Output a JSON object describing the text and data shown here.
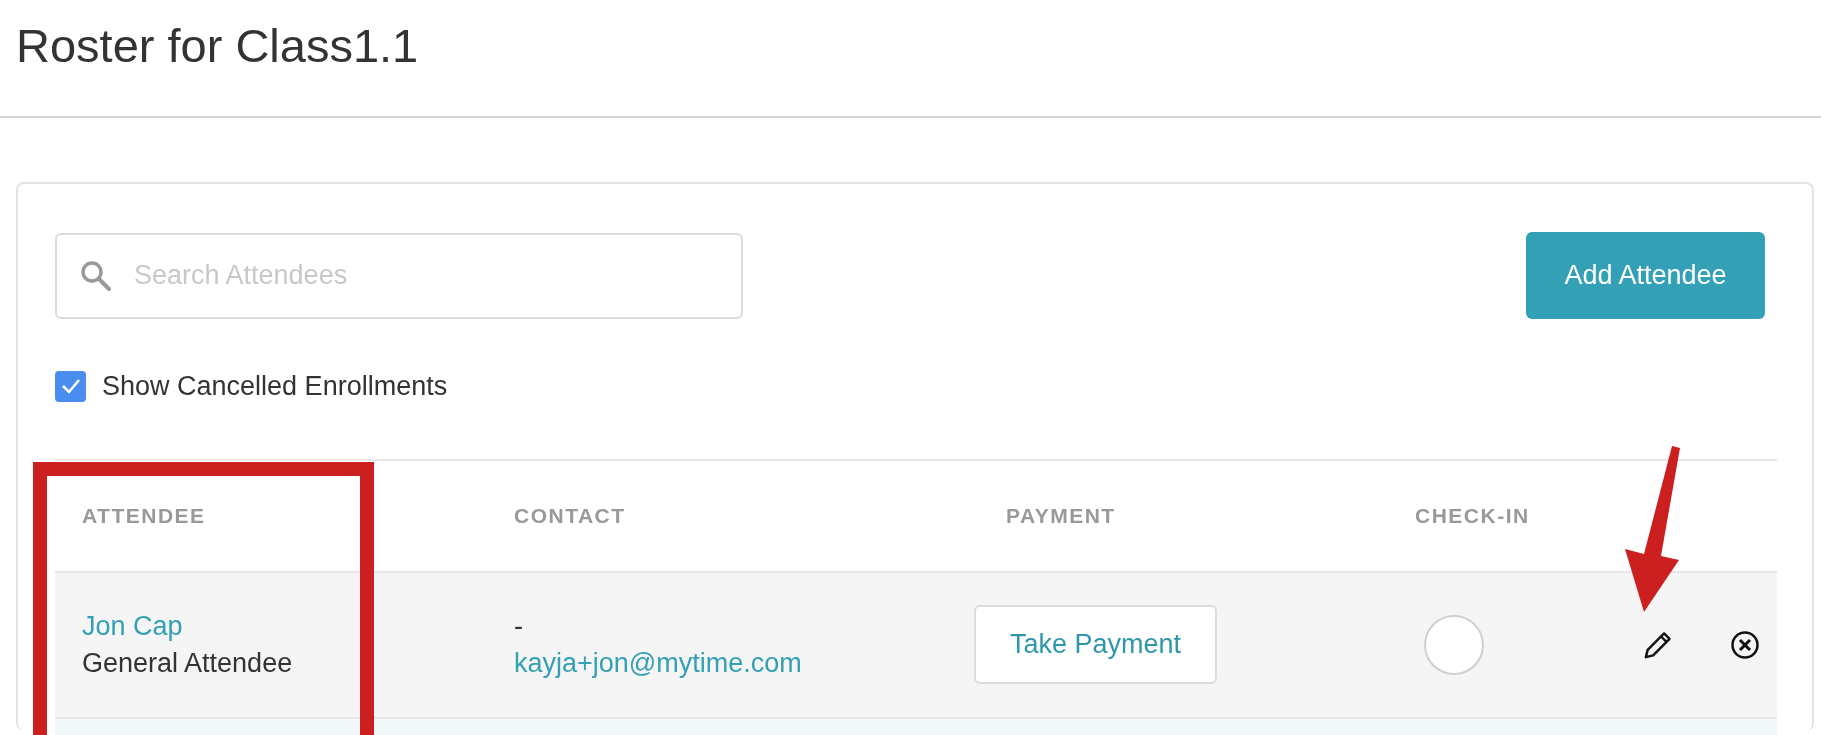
{
  "page": {
    "title": "Roster for Class1.1"
  },
  "search": {
    "placeholder": "Search Attendees"
  },
  "add_button": "Add Attendee",
  "show_cancelled": {
    "label": "Show Cancelled Enrollments",
    "checked": true
  },
  "table": {
    "columns": [
      "ATTENDEE",
      "CONTACT",
      "PAYMENT",
      "CHECK-IN"
    ],
    "rows": [
      {
        "name": "Jon Cap",
        "type": "General Attendee",
        "phone": "-",
        "email": "kayja+jon@mytime.com",
        "payment_action": "Take Payment",
        "checked_in": false
      }
    ]
  }
}
